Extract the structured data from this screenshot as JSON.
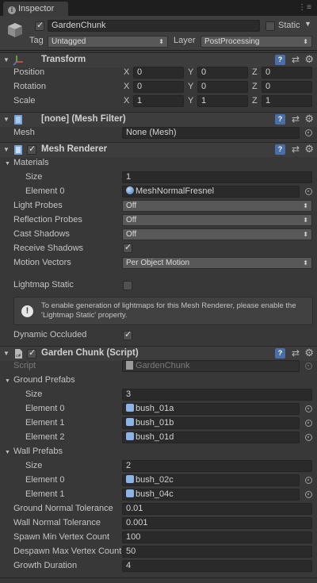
{
  "tab": {
    "title": "Inspector",
    "menu_glyph": "⋮≡"
  },
  "header": {
    "object_name": "GardenChunk",
    "active": true,
    "static_label": "Static",
    "static_checked": false,
    "tag_label": "Tag",
    "tag_value": "Untagged",
    "layer_label": "Layer",
    "layer_value": "PostProcessing"
  },
  "transform": {
    "title": "Transform",
    "rows": [
      {
        "label": "Position",
        "x": "0",
        "y": "0",
        "z": "0"
      },
      {
        "label": "Rotation",
        "x": "0",
        "y": "0",
        "z": "0"
      },
      {
        "label": "Scale",
        "x": "1",
        "y": "1",
        "z": "1"
      }
    ],
    "axes": {
      "x": "X",
      "y": "Y",
      "z": "Z"
    }
  },
  "mesh_filter": {
    "title": "[none] (Mesh Filter)",
    "mesh_label": "Mesh",
    "mesh_value": "None (Mesh)"
  },
  "mesh_renderer": {
    "title": "Mesh Renderer",
    "enabled": true,
    "materials_label": "Materials",
    "size_label": "Size",
    "size_value": "1",
    "element0_label": "Element 0",
    "element0_value": "MeshNormalFresnel",
    "light_probes_label": "Light Probes",
    "light_probes_value": "Off",
    "reflection_probes_label": "Reflection Probes",
    "reflection_probes_value": "Off",
    "cast_shadows_label": "Cast Shadows",
    "cast_shadows_value": "Off",
    "receive_shadows_label": "Receive Shadows",
    "receive_shadows": true,
    "motion_vectors_label": "Motion Vectors",
    "motion_vectors_value": "Per Object Motion",
    "lightmap_static_label": "Lightmap Static",
    "lightmap_static": false,
    "info_text": "To enable generation of lightmaps for this Mesh Renderer, please enable the 'Lightmap Static' property.",
    "dynamic_occluded_label": "Dynamic Occluded",
    "dynamic_occluded": true
  },
  "script_comp": {
    "title": "Garden Chunk (Script)",
    "enabled": true,
    "script_label": "Script",
    "script_value": "GardenChunk",
    "ground_prefabs_label": "Ground Prefabs",
    "ground_size_label": "Size",
    "ground_size_value": "3",
    "ground_elements": [
      {
        "label": "Element 0",
        "value": "bush_01a"
      },
      {
        "label": "Element 1",
        "value": "bush_01b"
      },
      {
        "label": "Element 2",
        "value": "bush_01d"
      }
    ],
    "wall_prefabs_label": "Wall Prefabs",
    "wall_size_label": "Size",
    "wall_size_value": "2",
    "wall_elements": [
      {
        "label": "Element 0",
        "value": "bush_02c"
      },
      {
        "label": "Element 1",
        "value": "bush_04c"
      }
    ],
    "ground_normal_label": "Ground Normal Tolerance",
    "ground_normal_value": "0.01",
    "wall_normal_label": "Wall Normal Tolerance",
    "wall_normal_value": "0.001",
    "spawn_min_label": "Spawn Min Vertex Count",
    "spawn_min_value": "100",
    "despawn_max_label": "Despawn Max Vertex Count",
    "despawn_max_value": "50",
    "growth_label": "Growth Duration",
    "growth_value": "4"
  },
  "icons": {
    "help": "help-icon",
    "preset": "preset-icon",
    "gear": "gear-icon"
  },
  "colors": {
    "background": "#383838",
    "field": "#2a2a2a",
    "help_blue": "#4a6fa8",
    "object_ref": "#8bb4e8"
  }
}
